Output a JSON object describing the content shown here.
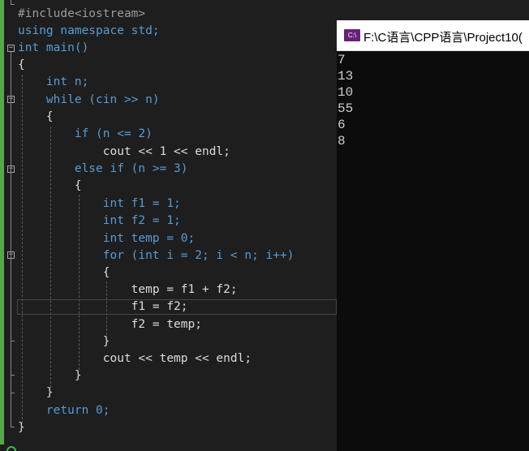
{
  "editor": {
    "lines": [
      "#include<iostream>",
      "using namespace std;",
      "int main()",
      "{",
      "    int n;",
      "    while (cin >> n)",
      "    {",
      "        if (n <= 2)",
      "            cout << 1 << endl;",
      "        else if (n >= 3)",
      "        {",
      "            int f1 = 1;",
      "            int f2 = 1;",
      "            int temp = 0;",
      "            for (int i = 2; i < n; i++)",
      "            {",
      "                temp = f1 + f2;",
      "                f1 = f2;",
      "                f2 = temp;",
      "            }",
      "            cout << temp << endl;",
      "        }",
      "    }",
      "    return 0;",
      "}"
    ]
  },
  "console": {
    "title": "F:\\C语言\\CPP语言\\Project10(",
    "icon_label": "C:\\",
    "output": [
      "7",
      "13",
      "10",
      "55",
      "6",
      "8"
    ]
  },
  "colors": {
    "editor_bg": "#1e1e1e",
    "keyword": "#569cd6",
    "preprocessor": "#9b9b9b",
    "number": "#b5cea8",
    "text": "#dcdcdc",
    "console_bg": "#0c0c0c",
    "console_text": "#cccccc",
    "change_bar": "#57a64a"
  }
}
